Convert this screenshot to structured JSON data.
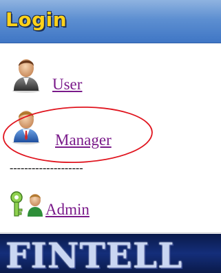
{
  "header": {
    "title": "Login"
  },
  "menu": {
    "items": [
      {
        "label": "User",
        "icon": "user-avatar-icon"
      },
      {
        "label": "Manager",
        "icon": "manager-avatar-icon",
        "highlighted": true
      },
      {
        "label": "Admin",
        "icon": "admin-keys-icon"
      }
    ],
    "divider": "--------------------"
  },
  "banner": {
    "text": "FINTELL"
  },
  "colors": {
    "header_top": "#8fb3e0",
    "header_bottom": "#3f76c5",
    "title_yellow": "#ffd21a",
    "link_purple": "#7a1a8a",
    "highlight_red": "#e0141e",
    "banner_navy": "#142e7a"
  }
}
